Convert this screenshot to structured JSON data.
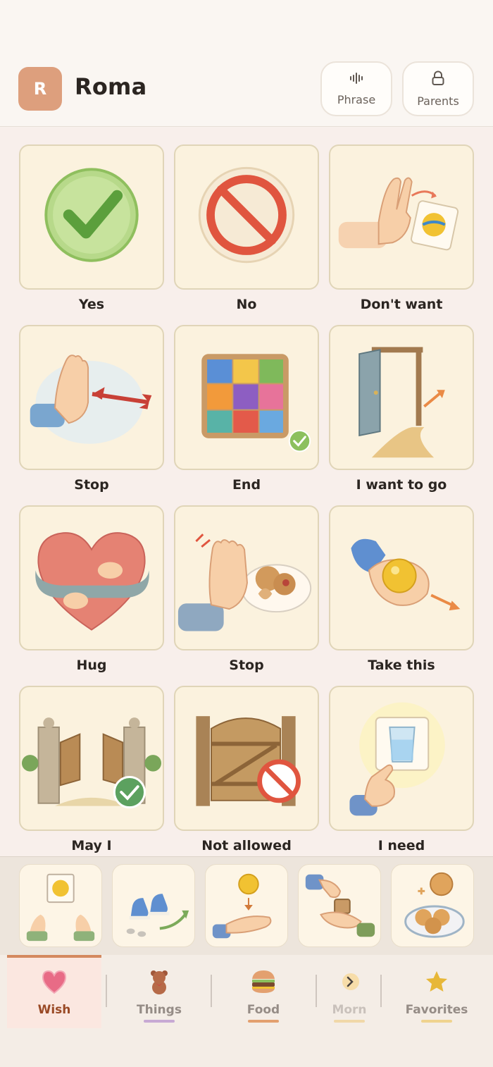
{
  "header": {
    "avatar_letter": "R",
    "profile_name": "Roma",
    "phrase_label": "Phrase",
    "parents_label": "Parents",
    "avatar_color": "#dd9f7d"
  },
  "grid": {
    "tiles": [
      {
        "label": "Yes",
        "icon": "check-circle-icon"
      },
      {
        "label": "No",
        "icon": "prohibited-icon"
      },
      {
        "label": "Don't want",
        "icon": "hand-pushing-away-icon"
      },
      {
        "label": "Stop",
        "icon": "stop-hand-icon"
      },
      {
        "label": "End",
        "icon": "completed-puzzle-icon"
      },
      {
        "label": "I want to go",
        "icon": "open-door-icon"
      },
      {
        "label": "Hug",
        "icon": "hugging-heart-icon"
      },
      {
        "label": "Stop",
        "icon": "hand-stop-cookies-icon"
      },
      {
        "label": "Take this",
        "icon": "hand-giving-ball-icon"
      },
      {
        "label": "May I",
        "icon": "open-gate-icon"
      },
      {
        "label": "Not allowed",
        "icon": "closed-gate-icon"
      },
      {
        "label": "I need",
        "icon": "pointing-water-icon"
      }
    ]
  },
  "strip": {
    "cards": [
      {
        "icon": "hands-ball-card-icon"
      },
      {
        "icon": "shoes-walking-icon"
      },
      {
        "icon": "ball-into-hand-icon"
      },
      {
        "icon": "passing-block-icon"
      },
      {
        "icon": "cookies-plate-icon"
      }
    ]
  },
  "nav": {
    "tabs": [
      {
        "label": "Wish",
        "icon": "heart-icon",
        "active": true,
        "accent": "#d4895f"
      },
      {
        "label": "Things",
        "icon": "teddy-bear-icon",
        "active": false,
        "accent": "#c7a9d4"
      },
      {
        "label": "Food",
        "icon": "burger-icon",
        "active": false,
        "accent": "#e3a06f"
      },
      {
        "label": "Morn",
        "icon": "sunrise-icon",
        "active": false,
        "accent": "#f0d8a8"
      },
      {
        "label": "Favorites",
        "icon": "star-icon",
        "active": false,
        "accent": "#efd38e"
      }
    ]
  }
}
